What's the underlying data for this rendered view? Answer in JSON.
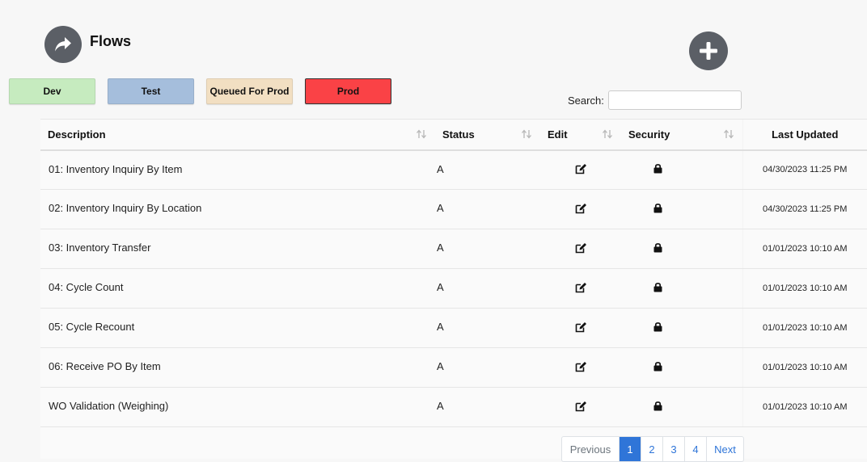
{
  "header": {
    "title": "Flows",
    "flows_icon": "share-arrow-icon",
    "add_icon": "plus-icon"
  },
  "environments": [
    {
      "label": "Dev",
      "color": "#c6ebbf"
    },
    {
      "label": "Test",
      "color": "#a5bedc"
    },
    {
      "label": "Queued For Prod",
      "color": "#f2dfc2"
    },
    {
      "label": "Prod",
      "color": "#fa4246"
    }
  ],
  "search": {
    "label": "Search:",
    "value": "",
    "placeholder": ""
  },
  "table": {
    "columns": [
      "Description",
      "Status",
      "Edit",
      "Security",
      "Last Updated"
    ],
    "rows": [
      {
        "description": "01: Inventory Inquiry By Item",
        "status": "A",
        "last_updated": "04/30/2023 11:25 PM"
      },
      {
        "description": "02: Inventory Inquiry By Location",
        "status": "A",
        "last_updated": "04/30/2023 11:25 PM"
      },
      {
        "description": "03: Inventory Transfer",
        "status": "A",
        "last_updated": "01/01/2023 10:10 AM"
      },
      {
        "description": "04: Cycle Count",
        "status": "A",
        "last_updated": "01/01/2023 10:10 AM"
      },
      {
        "description": "05: Cycle Recount",
        "status": "A",
        "last_updated": "01/01/2023 10:10 AM"
      },
      {
        "description": "06: Receive PO By Item",
        "status": "A",
        "last_updated": "01/01/2023 10:10 AM"
      },
      {
        "description": "WO Validation (Weighing)",
        "status": "A",
        "last_updated": "01/01/2023 10:10 AM"
      }
    ]
  },
  "pagination": {
    "previous": "Previous",
    "pages": [
      "1",
      "2",
      "3",
      "4"
    ],
    "active_page": "1",
    "next": "Next"
  },
  "colors": {
    "accent": "#2f75d8",
    "icon_bg": "#5b5f66"
  }
}
